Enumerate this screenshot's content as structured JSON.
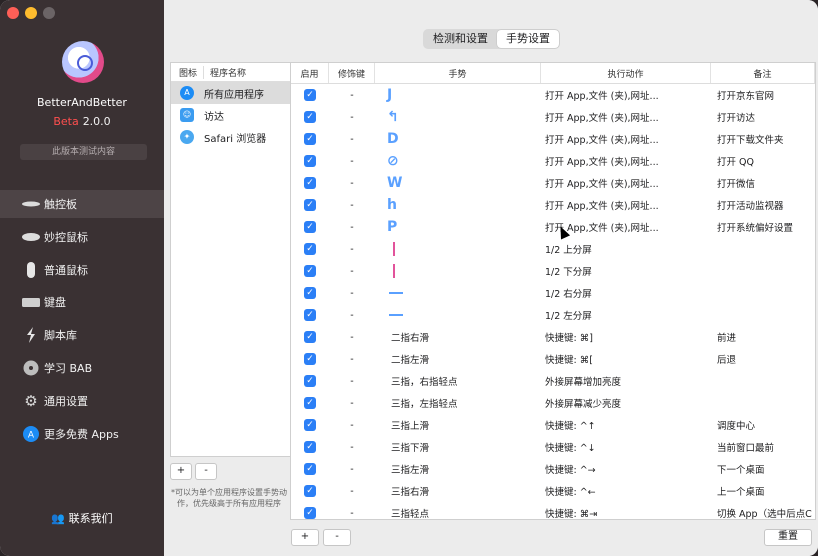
{
  "app": {
    "name": "BetterAndBetter",
    "beta_label": "Beta",
    "version": "2.0.0",
    "test_button": "此版本测试内容",
    "contact": "联系我们"
  },
  "nav": [
    {
      "label": "触控板",
      "icon": "trackpad-icon"
    },
    {
      "label": "妙控鼠标",
      "icon": "magic-mouse-icon"
    },
    {
      "label": "普通鼠标",
      "icon": "mouse-icon"
    },
    {
      "label": "键盘",
      "icon": "keyboard-icon"
    },
    {
      "label": "脚本库",
      "icon": "script-icon"
    },
    {
      "label": "学习 BAB",
      "icon": "learn-icon"
    },
    {
      "label": "通用设置",
      "icon": "gear-icon"
    },
    {
      "label": "更多免费 Apps",
      "icon": "app-store-icon"
    }
  ],
  "tabs": [
    "检测和设置",
    "手势设置"
  ],
  "applist": {
    "header_icon": "图标",
    "header_name": "程序名称",
    "items": [
      "所有应用程序",
      "访达",
      "Safari 浏览器"
    ],
    "add": "+",
    "remove": "-",
    "note": "*可以为单个应用程序设置手势动作，优先级高于所有应用程序"
  },
  "table": {
    "headers": [
      "启用",
      "修饰键",
      "手势",
      "执行动作",
      "备注"
    ],
    "rows": [
      {
        "mod": "-",
        "gesture": "J",
        "action": "打开 App,文件 (夹),网址...",
        "note": "打开京东官网"
      },
      {
        "mod": "-",
        "gesture": "↰",
        "action": "打开 App,文件 (夹),网址...",
        "note": "打开访达"
      },
      {
        "mod": "-",
        "gesture": "D",
        "action": "打开 App,文件 (夹),网址...",
        "note": "打开下载文件夹"
      },
      {
        "mod": "-",
        "gesture": "⊘",
        "action": "打开 App,文件 (夹),网址...",
        "note": "打开 QQ"
      },
      {
        "mod": "-",
        "gesture": "W",
        "action": "打开 App,文件 (夹),网址...",
        "note": "打开微信"
      },
      {
        "mod": "-",
        "gesture": "h",
        "action": "打开 App,文件 (夹),网址...",
        "note": "打开活动监视器"
      },
      {
        "mod": "-",
        "gesture": "P",
        "action": "打开 App,文件 (夹),网址...",
        "note": "打开系统偏好设置"
      },
      {
        "mod": "-",
        "gesture": "",
        "action": "1/2 上分屏",
        "note": ""
      },
      {
        "mod": "-",
        "gesture": "",
        "action": "1/2 下分屏",
        "note": ""
      },
      {
        "mod": "-",
        "gesture": "",
        "action": "1/2 右分屏",
        "note": ""
      },
      {
        "mod": "-",
        "gesture": "",
        "action": "1/2 左分屏",
        "note": ""
      },
      {
        "mod": "-",
        "gesture": "二指右滑",
        "action": "快捷键: ⌘]",
        "note": "前进"
      },
      {
        "mod": "-",
        "gesture": "二指左滑",
        "action": "快捷键: ⌘[",
        "note": "后退"
      },
      {
        "mod": "-",
        "gesture": "三指，右指轻点",
        "action": "外接屏幕增加亮度",
        "note": ""
      },
      {
        "mod": "-",
        "gesture": "三指，左指轻点",
        "action": "外接屏幕减少亮度",
        "note": ""
      },
      {
        "mod": "-",
        "gesture": "三指上滑",
        "action": "快捷键: ^↑",
        "note": "调度中心"
      },
      {
        "mod": "-",
        "gesture": "三指下滑",
        "action": "快捷键: ^↓",
        "note": "当前窗口最前"
      },
      {
        "mod": "-",
        "gesture": "三指左滑",
        "action": "快捷键: ^→",
        "note": "下一个桌面"
      },
      {
        "mod": "-",
        "gesture": "三指右滑",
        "action": "快捷键: ^←",
        "note": "上一个桌面"
      },
      {
        "mod": "-",
        "gesture": "三指轻点",
        "action": "快捷键: ⌘⇥",
        "note": "切换 App（选中后点C"
      }
    ],
    "add": "+",
    "remove": "-",
    "reset": "重置"
  },
  "colors": {
    "sidebar": "#3a3133",
    "accent": "#2b7ff6",
    "beta": "#ff4f4f"
  }
}
